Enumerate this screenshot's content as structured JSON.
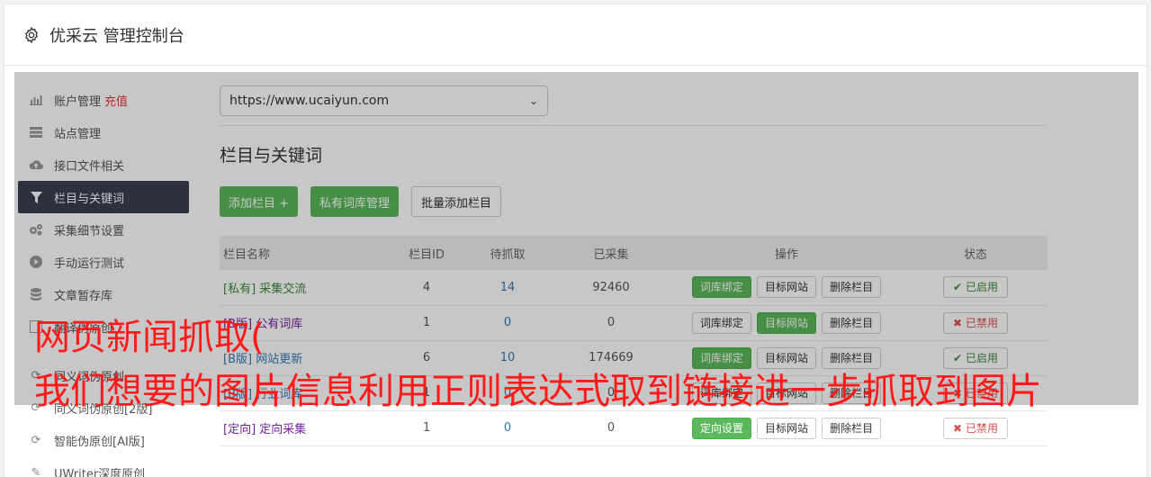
{
  "header": {
    "title": "优采云 管理控制台",
    "icon": "gear-icon"
  },
  "sidebar": {
    "items": [
      {
        "label": "账户管理",
        "extra": "充值",
        "icon": "bar-chart-icon"
      },
      {
        "label": "站点管理",
        "icon": "server-icon"
      },
      {
        "label": "接口文件相关",
        "icon": "cloud-upload-icon"
      },
      {
        "label": "栏目与关键词",
        "icon": "filter-icon",
        "active": true
      },
      {
        "label": "采集细节设置",
        "icon": "cogs-icon"
      },
      {
        "label": "手动运行测试",
        "icon": "play-circle-icon"
      },
      {
        "label": "文章暂存库",
        "icon": "database-icon"
      },
      {
        "label": "翻译伪原创",
        "icon": "translate-icon"
      },
      {
        "label": "同义词伪原创",
        "icon": "refresh-icon"
      },
      {
        "label": "同义词伪原创[2版]",
        "icon": "refresh-icon"
      },
      {
        "label": "智能伪原创[AI版]",
        "icon": "refresh-icon"
      },
      {
        "label": "UWriter深度原创",
        "icon": "edit-icon"
      }
    ]
  },
  "main": {
    "site_select": "https://www.ucaiyun.com",
    "section_title": "栏目与关键词",
    "buttons": {
      "add": "添加栏目 +",
      "private_lib": "私有词库管理",
      "batch_add": "批量添加栏目"
    },
    "table": {
      "headers": [
        "栏目名称",
        "栏目ID",
        "待抓取",
        "已采集",
        "操作",
        "状态"
      ],
      "rows": [
        {
          "tag": "[私有]",
          "name": "采集交流",
          "id": "4",
          "pending": "14",
          "collected": "92460",
          "op1": "词库绑定",
          "op2": "目标网站",
          "op3": "删除栏目",
          "status": "已启用",
          "status_icon": "✔"
        },
        {
          "tag": "[B版]",
          "name": "公有词库",
          "id": "1",
          "pending": "0",
          "collected": "0",
          "op1": "词库绑定",
          "op2": "目标网站",
          "op3": "删除栏目",
          "status": "已禁用",
          "status_icon": "✖"
        },
        {
          "tag": "[B版]",
          "name": "网站更新",
          "id": "6",
          "pending": "10",
          "collected": "174669",
          "op1": "词库绑定",
          "op2": "目标网站",
          "op3": "删除栏目",
          "status": "已启用",
          "status_icon": "✔"
        },
        {
          "tag": "[B版]",
          "name": "行业词库",
          "id": "1",
          "pending": "0",
          "collected": "0",
          "op1": "词库绑定",
          "op2": "目标网站",
          "op3": "删除栏目",
          "status": "已禁用",
          "status_icon": "✖"
        },
        {
          "tag": "[定向]",
          "name": "定向采集",
          "id": "1",
          "pending": "0",
          "collected": "0",
          "op1": "定向设置",
          "op2": "目标网站",
          "op3": "删除栏目",
          "status": "已禁用",
          "status_icon": "✖"
        }
      ]
    }
  },
  "caption": {
    "line1": "网页新闻抓取(",
    "line2": "我们想要的图片信息利用正则表达式取到链接进一步抓取到图片"
  }
}
